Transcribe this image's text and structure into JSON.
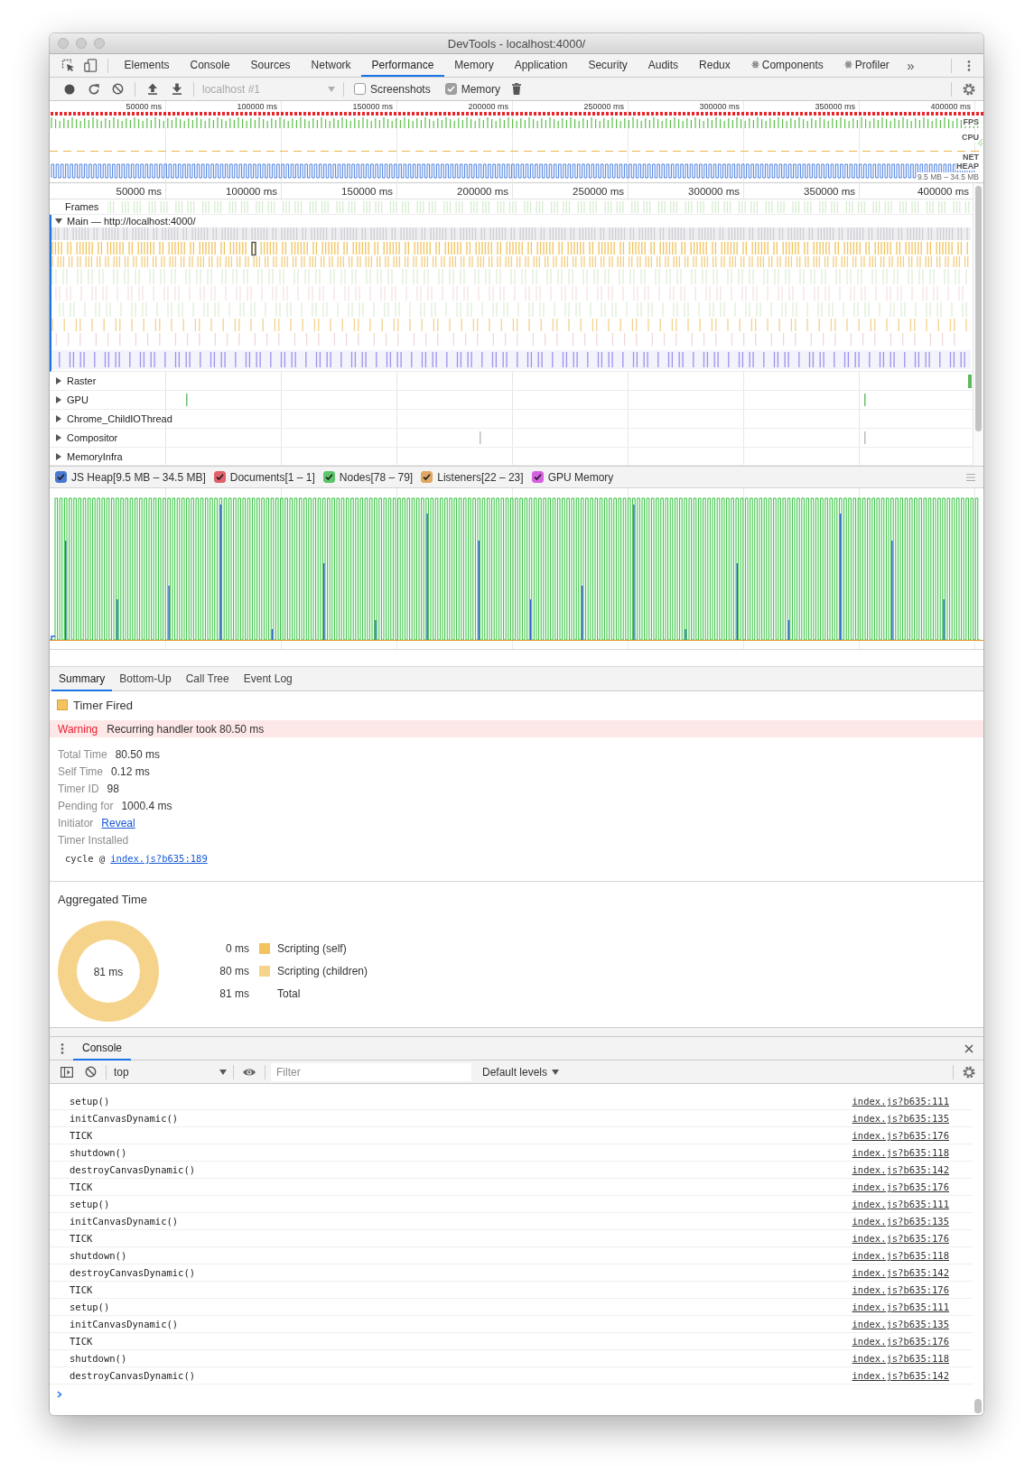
{
  "window": {
    "title": "DevTools - localhost:4000/"
  },
  "tabs": [
    {
      "label": "Elements",
      "selected": false,
      "kind": "plain"
    },
    {
      "label": "Console",
      "selected": false,
      "kind": "plain"
    },
    {
      "label": "Sources",
      "selected": false,
      "kind": "plain"
    },
    {
      "label": "Network",
      "selected": false,
      "kind": "plain"
    },
    {
      "label": "Performance",
      "selected": true,
      "kind": "plain"
    },
    {
      "label": "Memory",
      "selected": false,
      "kind": "plain"
    },
    {
      "label": "Application",
      "selected": false,
      "kind": "plain"
    },
    {
      "label": "Security",
      "selected": false,
      "kind": "plain"
    },
    {
      "label": "Audits",
      "selected": false,
      "kind": "plain"
    },
    {
      "label": "Redux",
      "selected": false,
      "kind": "plain"
    },
    {
      "label": "Components",
      "selected": false,
      "kind": "react"
    },
    {
      "label": "Profiler",
      "selected": false,
      "kind": "react"
    }
  ],
  "tab_overflow": "»",
  "toolbar": {
    "target": {
      "value": "localhost #1",
      "disabled": true
    },
    "options": [
      {
        "label": "Screenshots",
        "checked": false
      },
      {
        "label": "Memory",
        "checked": true
      }
    ]
  },
  "overview": {
    "ticks": [
      "50000 ms",
      "100000 ms",
      "150000 ms",
      "200000 ms",
      "250000 ms",
      "300000 ms",
      "350000 ms",
      "400000 ms"
    ],
    "tracks": [
      "FPS",
      "CPU",
      "NET",
      "HEAP"
    ],
    "heap_range": "9.5 MB – 34.5 MB"
  },
  "timeline": {
    "ticks": [
      "50000 ms",
      "100000 ms",
      "150000 ms",
      "200000 ms",
      "250000 ms",
      "300000 ms",
      "350000 ms",
      "400000 ms"
    ],
    "frames_label": "Frames",
    "main": {
      "label": "Main — http://localhost:4000/",
      "expanded": true
    },
    "threads": [
      {
        "label": "Raster",
        "expanded": false
      },
      {
        "label": "GPU",
        "expanded": false
      },
      {
        "label": "Chrome_ChildIOThread",
        "expanded": false
      },
      {
        "label": "Compositor",
        "expanded": false
      },
      {
        "label": "MemoryInfra",
        "expanded": false
      }
    ]
  },
  "counters": [
    {
      "label": "JS Heap[9.5 MB – 34.5 MB]",
      "checked": true,
      "color": "#4a78d0"
    },
    {
      "label": "Documents[1 – 1]",
      "checked": true,
      "color": "#e0606c"
    },
    {
      "label": "Nodes[78 – 79]",
      "checked": true,
      "color": "#5cc46a"
    },
    {
      "label": "Listeners[22 – 23]",
      "checked": true,
      "color": "#e0a862"
    },
    {
      "label": "GPU Memory",
      "checked": true,
      "color": "#d660e0"
    }
  ],
  "details_tabs": [
    {
      "label": "Summary",
      "selected": true
    },
    {
      "label": "Bottom-Up",
      "selected": false
    },
    {
      "label": "Call Tree",
      "selected": false
    },
    {
      "label": "Event Log",
      "selected": false
    }
  ],
  "summary": {
    "title": "Timer Fired",
    "warning": {
      "label": "Warning",
      "text": "Recurring handler took 80.50 ms"
    },
    "rows": [
      {
        "label": "Total Time",
        "value": "80.50 ms"
      },
      {
        "label": "Self Time",
        "value": "0.12 ms"
      },
      {
        "label": "Timer ID",
        "value": "98"
      },
      {
        "label": "Pending for",
        "value": "1000.4 ms"
      },
      {
        "label": "Initiator",
        "link": "Reveal"
      },
      {
        "label": "Timer Installed"
      }
    ],
    "stack": {
      "text": "cycle @",
      "link": "index.js?b635:189"
    }
  },
  "aggregated": {
    "title": "Aggregated Time",
    "total_label": "81 ms",
    "legend": [
      {
        "value": "0 ms",
        "label": "Scripting (self)",
        "color": "#f2c35e"
      },
      {
        "value": "80 ms",
        "label": "Scripting (children)",
        "color": "#f6d38a"
      },
      {
        "value": "81 ms",
        "label": "Total"
      }
    ]
  },
  "console": {
    "tabs": [
      {
        "label": "Console",
        "selected": true
      }
    ],
    "context": "top",
    "filter": {
      "placeholder": "Filter"
    },
    "levels": "Default levels",
    "messages": [
      {
        "text": "setup()",
        "source": "index.js?b635:111"
      },
      {
        "text": "initCanvasDynamic()",
        "source": "index.js?b635:135"
      },
      {
        "text": "TICK",
        "source": "index.js?b635:176"
      },
      {
        "text": "shutdown()",
        "source": "index.js?b635:118"
      },
      {
        "text": "destroyCanvasDynamic()",
        "source": "index.js?b635:142"
      },
      {
        "text": "TICK",
        "source": "index.js?b635:176"
      },
      {
        "text": "setup()",
        "source": "index.js?b635:111"
      },
      {
        "text": "initCanvasDynamic()",
        "source": "index.js?b635:135"
      },
      {
        "text": "TICK",
        "source": "index.js?b635:176"
      },
      {
        "text": "shutdown()",
        "source": "index.js?b635:118"
      },
      {
        "text": "destroyCanvasDynamic()",
        "source": "index.js?b635:142"
      },
      {
        "text": "TICK",
        "source": "index.js?b635:176"
      },
      {
        "text": "setup()",
        "source": "index.js?b635:111"
      },
      {
        "text": "initCanvasDynamic()",
        "source": "index.js?b635:135"
      },
      {
        "text": "TICK",
        "source": "index.js?b635:176"
      },
      {
        "text": "shutdown()",
        "source": "index.js?b635:118"
      },
      {
        "text": "destroyCanvasDynamic()",
        "source": "index.js?b635:142"
      }
    ]
  }
}
